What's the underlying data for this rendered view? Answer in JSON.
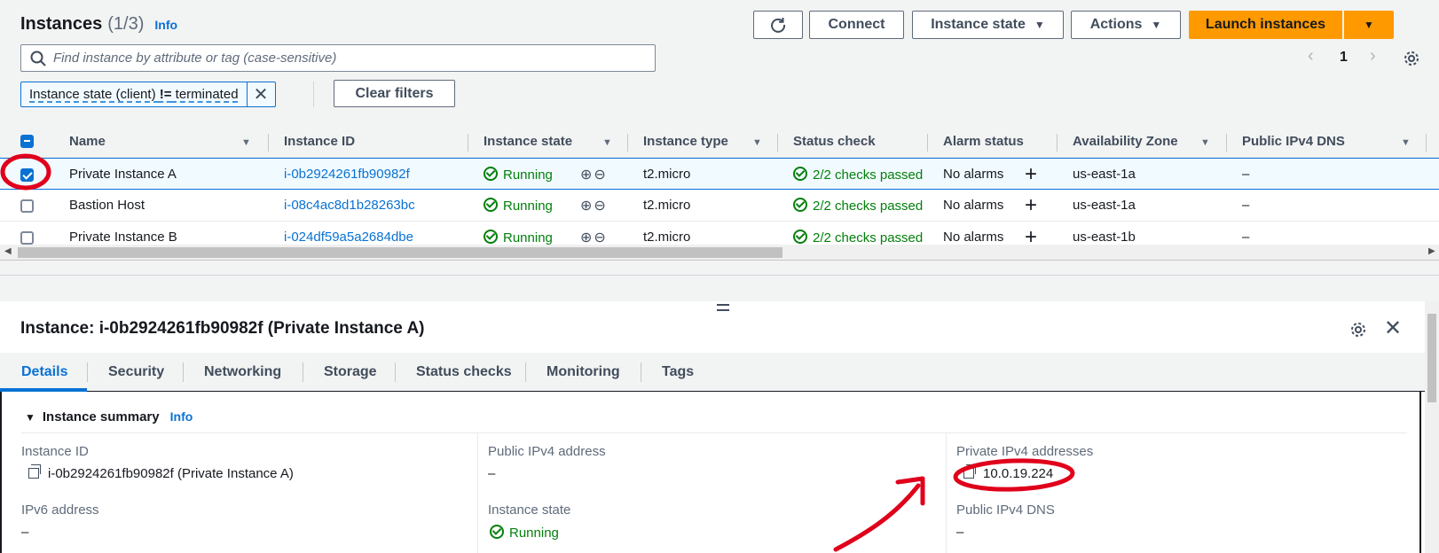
{
  "header": {
    "title": "Instances",
    "count": "(1/3)",
    "info": "Info"
  },
  "toolbar": {
    "connect": "Connect",
    "instance_state": "Instance state",
    "actions": "Actions",
    "launch": "Launch instances"
  },
  "search": {
    "placeholder": "Find instance by attribute or tag (case-sensitive)"
  },
  "filter": {
    "prefix": "Instance state (client) ",
    "operator": "!=",
    "value": " terminated",
    "clear": "Clear filters"
  },
  "pagination": {
    "page": "1"
  },
  "table": {
    "columns": [
      "Name",
      "Instance ID",
      "Instance state",
      "Instance type",
      "Status check",
      "Alarm status",
      "Availability Zone",
      "Public IPv4 DNS"
    ],
    "rows": [
      {
        "name": "Private Instance A",
        "id": "i-0b2924261fb90982f",
        "state": "Running",
        "type": "t2.micro",
        "status": "2/2 checks passed",
        "alarm": "No alarms",
        "az": "us-east-1a",
        "dns": "–",
        "selected": true
      },
      {
        "name": "Bastion Host",
        "id": "i-08c4ac8d1b28263bc",
        "state": "Running",
        "type": "t2.micro",
        "status": "2/2 checks passed",
        "alarm": "No alarms",
        "az": "us-east-1a",
        "dns": "–",
        "selected": false
      },
      {
        "name": "Private Instance B",
        "id": "i-024df59a5a2684dbe",
        "state": "Running",
        "type": "t2.micro",
        "status": "2/2 checks passed",
        "alarm": "No alarms",
        "az": "us-east-1b",
        "dns": "–",
        "selected": false
      }
    ]
  },
  "detail": {
    "title": "Instance: i-0b2924261fb90982f (Private Instance A)",
    "tabs": [
      "Details",
      "Security",
      "Networking",
      "Storage",
      "Status checks",
      "Monitoring",
      "Tags"
    ],
    "summary_title": "Instance summary",
    "summary_info": "Info",
    "fields": {
      "instance_id_label": "Instance ID",
      "instance_id_value": "i-0b2924261fb90982f (Private Instance A)",
      "public_ipv4_label": "Public IPv4 address",
      "public_ipv4_value": "–",
      "private_ipv4_label": "Private IPv4 addresses",
      "private_ipv4_value": "10.0.19.224",
      "ipv6_label": "IPv6 address",
      "ipv6_value": "–",
      "instance_state_label": "Instance state",
      "instance_state_value": "Running",
      "public_dns_label": "Public IPv4 DNS",
      "public_dns_value": "–"
    }
  },
  "colors": {
    "accent": "#0972d3",
    "launch": "#ff9900",
    "success": "#037f0c",
    "annotation": "#e0001b"
  }
}
